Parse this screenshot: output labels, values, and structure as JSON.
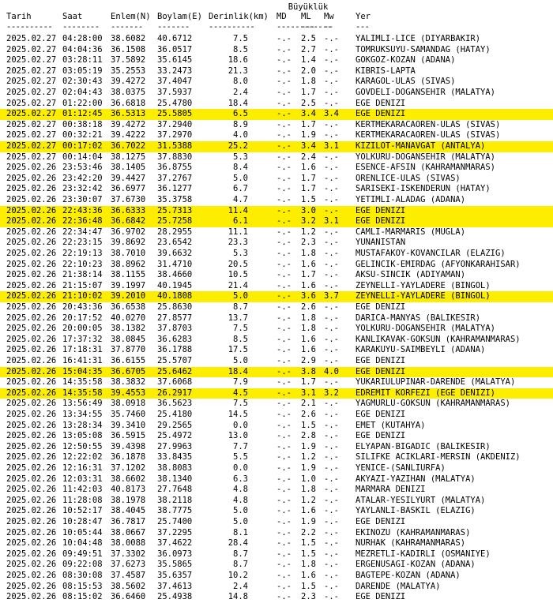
{
  "header": {
    "group_label": "Büyüklük",
    "columns": [
      "Tarih",
      "Saat",
      "Enlem(N)",
      "Boylam(E)",
      "Derinlik(km)",
      "MD",
      "ML",
      "Mw",
      "Yer"
    ],
    "separators": [
      "----------",
      "--------",
      "-------",
      "-------",
      "----------",
      "------------",
      "---",
      "--",
      "---"
    ]
  },
  "rows": [
    [
      "2025.02.27",
      "04:28:00",
      "38.6082",
      "40.6712",
      "7.5",
      "-.-",
      "2.5",
      "-.-",
      "YALIMLI-LICE (DIYARBAKIR)",
      false
    ],
    [
      "2025.02.27",
      "04:04:36",
      "36.1508",
      "36.0517",
      "8.5",
      "-.-",
      "2.7",
      "-.-",
      "TOMRUKSUYU-SAMANDAG (HATAY)",
      false
    ],
    [
      "2025.02.27",
      "03:28:11",
      "37.5892",
      "35.6145",
      "18.6",
      "-.-",
      "1.4",
      "-.-",
      "GOKGOZ-KOZAN (ADANA)",
      false
    ],
    [
      "2025.02.27",
      "03:05:19",
      "35.2553",
      "33.2473",
      "21.3",
      "-.-",
      "2.0",
      "-.-",
      "KIBRIS-LAPTA",
      false
    ],
    [
      "2025.02.27",
      "02:30:43",
      "39.4272",
      "37.4047",
      "8.0",
      "-.-",
      "1.8",
      "-.-",
      "KARAGOL-ULAS (SIVAS)",
      false
    ],
    [
      "2025.02.27",
      "02:04:43",
      "38.0375",
      "37.5937",
      "2.4",
      "-.-",
      "1.7",
      "-.-",
      "GOVDELI-DOGANSEHIR (MALATYA)",
      false
    ],
    [
      "2025.02.27",
      "01:22:00",
      "36.6818",
      "25.4780",
      "18.4",
      "-.-",
      "2.5",
      "-.-",
      "EGE DENIZI",
      false
    ],
    [
      "2025.02.27",
      "01:12:45",
      "36.5313",
      "25.5805",
      "6.5",
      "-.-",
      "3.4",
      "3.4",
      "EGE DENIZI",
      true
    ],
    [
      "2025.02.27",
      "00:38:18",
      "39.4272",
      "37.2940",
      "8.9",
      "-.-",
      "1.7",
      "-.-",
      "KERTMEKARACAOREN-ULAS (SIVAS)",
      false
    ],
    [
      "2025.02.27",
      "00:32:21",
      "39.4222",
      "37.2970",
      "4.0",
      "-.-",
      "1.9",
      "-.-",
      "KERTMEKARACAOREN-ULAS (SIVAS)",
      false
    ],
    [
      "2025.02.27",
      "00:17:02",
      "36.7022",
      "31.5388",
      "25.2",
      "-.-",
      "3.4",
      "3.1",
      "KIZILOT-MANAVGAT (ANTALYA)",
      true
    ],
    [
      "2025.02.27",
      "00:14:04",
      "38.1275",
      "37.8830",
      "5.3",
      "-.-",
      "2.4",
      "-.-",
      "YOLKURU-DOGANSEHIR (MALATYA)",
      false
    ],
    [
      "2025.02.26",
      "23:53:46",
      "38.1405",
      "36.8755",
      "8.4",
      "-.-",
      "1.6",
      "-.-",
      "ESENCE-AFSIN (KAHRAMANMARAS)",
      false
    ],
    [
      "2025.02.26",
      "23:42:20",
      "39.4427",
      "37.2767",
      "5.0",
      "-.-",
      "1.7",
      "-.-",
      "ORENLICE-ULAS (SIVAS)",
      false
    ],
    [
      "2025.02.26",
      "23:32:42",
      "36.6977",
      "36.1277",
      "6.7",
      "-.-",
      "1.7",
      "-.-",
      "SARISEKI-ISKENDERUN (HATAY)",
      false
    ],
    [
      "2025.02.26",
      "23:30:07",
      "37.6730",
      "35.3758",
      "4.7",
      "-.-",
      "1.5",
      "-.-",
      "YETIMLI-ALADAG (ADANA)",
      false
    ],
    [
      "2025.02.26",
      "22:43:36",
      "36.6333",
      "25.7313",
      "11.4",
      "-.-",
      "3.0",
      "-.-",
      "EGE DENIZI",
      true
    ],
    [
      "2025.02.26",
      "22:36:48",
      "36.6842",
      "25.7258",
      "6.1",
      "-.-",
      "3.2",
      "3.1",
      "EGE DENIZI",
      true
    ],
    [
      "2025.02.26",
      "22:34:47",
      "36.9702",
      "28.2955",
      "11.1",
      "-.-",
      "1.2",
      "-.-",
      "CAMLI-MARMARIS (MUGLA)",
      false
    ],
    [
      "2025.02.26",
      "22:23:15",
      "39.8692",
      "23.6542",
      "23.3",
      "-.-",
      "2.3",
      "-.-",
      "YUNANISTAN",
      false
    ],
    [
      "2025.02.26",
      "22:19:13",
      "38.7010",
      "39.6632",
      "5.3",
      "-.-",
      "1.8",
      "-.-",
      "MUSTAFAKOY-KOVANCILAR (ELAZIG)",
      false
    ],
    [
      "2025.02.26",
      "22:10:23",
      "38.8962",
      "31.4710",
      "20.5",
      "-.-",
      "1.6",
      "-.-",
      "GELINCIK-EMIRDAG (AFYONKARAHISAR)",
      false
    ],
    [
      "2025.02.26",
      "21:38:14",
      "38.1155",
      "38.4660",
      "10.5",
      "-.-",
      "1.7",
      "-.-",
      "AKSU-SINCIK (ADIYAMAN)",
      false
    ],
    [
      "2025.02.26",
      "21:15:07",
      "39.1997",
      "40.1945",
      "21.4",
      "-.-",
      "1.6",
      "-.-",
      "ZEYNELLI-YAYLADERE (BINGOL)",
      false
    ],
    [
      "2025.02.26",
      "21:10:02",
      "39.2010",
      "40.1808",
      "5.0",
      "-.-",
      "3.6",
      "3.7",
      "ZEYNELLI-YAYLADERE (BINGOL)",
      true
    ],
    [
      "2025.02.26",
      "20:43:36",
      "36.6538",
      "25.8630",
      "8.7",
      "-.-",
      "2.6",
      "-.-",
      "EGE DENIZI",
      false
    ],
    [
      "2025.02.26",
      "20:17:52",
      "40.0270",
      "27.8577",
      "13.7",
      "-.-",
      "1.8",
      "-.-",
      "DARICA-MANYAS (BALIKESIR)",
      false
    ],
    [
      "2025.02.26",
      "20:00:05",
      "38.1382",
      "37.8703",
      "7.5",
      "-.-",
      "1.8",
      "-.-",
      "YOLKURU-DOGANSEHIR (MALATYA)",
      false
    ],
    [
      "2025.02.26",
      "17:37:32",
      "38.0845",
      "36.6283",
      "8.5",
      "-.-",
      "1.6",
      "-.-",
      "KANLIKAVAK-GOKSUN (KAHRAMANMARAS)",
      false
    ],
    [
      "2025.02.26",
      "17:18:31",
      "37.8770",
      "36.1788",
      "17.5",
      "-.-",
      "1.6",
      "-.-",
      "KARAKUYU-SAIMBEYLI (ADANA)",
      false
    ],
    [
      "2025.02.26",
      "16:41:31",
      "36.6155",
      "25.5707",
      "5.0",
      "-.-",
      "2.9",
      "-.-",
      "EGE DENIZI",
      false
    ],
    [
      "2025.02.26",
      "15:04:35",
      "36.6705",
      "25.6462",
      "18.4",
      "-.-",
      "3.8",
      "4.0",
      "EGE DENIZI",
      true
    ],
    [
      "2025.02.26",
      "14:35:58",
      "38.3832",
      "37.6068",
      "7.9",
      "-.-",
      "1.7",
      "-.-",
      "YUKARIULUPINAR-DARENDE (MALATYA)",
      false
    ],
    [
      "2025.02.26",
      "14:35:58",
      "39.4553",
      "26.2917",
      "4.5",
      "-.-",
      "3.1",
      "3.2",
      "EDREMIT KORFEZI (EGE DENIZI)",
      true
    ],
    [
      "2025.02.26",
      "13:56:49",
      "38.0918",
      "36.5623",
      "7.5",
      "-.-",
      "2.1",
      "-.-",
      "YAGMURLU-GOKSUN (KAHRAMANMARAS)",
      false
    ],
    [
      "2025.02.26",
      "13:34:55",
      "35.7460",
      "25.4180",
      "14.5",
      "-.-",
      "2.6",
      "-.-",
      "EGE DENIZI",
      false
    ],
    [
      "2025.02.26",
      "13:28:34",
      "39.3410",
      "29.2565",
      "0.0",
      "-.-",
      "1.5",
      "-.-",
      "EMET (KUTAHYA)",
      false
    ],
    [
      "2025.02.26",
      "13:05:08",
      "36.5915",
      "25.4972",
      "13.0",
      "-.-",
      "2.8",
      "-.-",
      "EGE DENIZI",
      false
    ],
    [
      "2025.02.26",
      "12:50:55",
      "39.4398",
      "27.9963",
      "7.7",
      "-.-",
      "1.9",
      "-.-",
      "ELYAPAN-BIGADIC (BALIKESIR)",
      false
    ],
    [
      "2025.02.26",
      "12:22:02",
      "36.1878",
      "33.8435",
      "5.5",
      "-.-",
      "1.2",
      "-.-",
      "SILIFKE ACIKLARI-MERSIN (AKDENIZ)",
      false
    ],
    [
      "2025.02.26",
      "12:16:31",
      "37.1202",
      "38.8083",
      "0.0",
      "-.-",
      "1.9",
      "-.-",
      "YENICE-(SANLIURFA)",
      false
    ],
    [
      "2025.02.26",
      "12:03:31",
      "38.6602",
      "38.1340",
      "6.3",
      "-.-",
      "1.0",
      "-.-",
      "AKYAZI-YAZIHAN (MALATYA)",
      false
    ],
    [
      "2025.02.26",
      "11:42:03",
      "40.8173",
      "27.7648",
      "4.8",
      "-.-",
      "1.8",
      "-.-",
      "MARMARA DENIZI",
      false
    ],
    [
      "2025.02.26",
      "11:28:08",
      "38.1978",
      "38.2118",
      "4.8",
      "-.-",
      "1.2",
      "-.-",
      "ATALAR-YESILYURT (MALATYA)",
      false
    ],
    [
      "2025.02.26",
      "10:52:17",
      "38.4045",
      "38.7775",
      "5.0",
      "-.-",
      "1.6",
      "-.-",
      "YAYLANLI-BASKIL (ELAZIG)",
      false
    ],
    [
      "2025.02.26",
      "10:28:47",
      "36.7817",
      "25.7400",
      "5.0",
      "-.-",
      "1.9",
      "-.-",
      "EGE DENIZI",
      false
    ],
    [
      "2025.02.26",
      "10:05:44",
      "38.0667",
      "37.2295",
      "8.1",
      "-.-",
      "2.2",
      "-.-",
      "EKINOZU (KAHRAMANMARAS)",
      false
    ],
    [
      "2025.02.26",
      "10:04:48",
      "38.0088",
      "37.4622",
      "28.4",
      "-.-",
      "1.5",
      "-.-",
      "NURHAK (KAHRAMANMARAS)",
      false
    ],
    [
      "2025.02.26",
      "09:49:51",
      "37.3302",
      "36.0973",
      "8.7",
      "-.-",
      "1.5",
      "-.-",
      "MEZRETLI-KADIRLI (OSMANIYE)",
      false
    ],
    [
      "2025.02.26",
      "09:22:08",
      "37.6273",
      "35.5865",
      "8.7",
      "-.-",
      "1.8",
      "-.-",
      "ERGENUSAGI-KOZAN (ADANA)",
      false
    ],
    [
      "2025.02.26",
      "08:30:08",
      "37.4587",
      "35.6357",
      "10.2",
      "-.-",
      "1.6",
      "-.-",
      "BAGTEPE-KOZAN (ADANA)",
      false
    ],
    [
      "2025.02.26",
      "08:15:53",
      "38.5602",
      "37.4613",
      "2.4",
      "-.-",
      "1.5",
      "-.-",
      "DARENDE (MALATYA)",
      false
    ],
    [
      "2025.02.26",
      "08:15:02",
      "36.6460",
      "25.4938",
      "14.8",
      "-.-",
      "2.3",
      "-.-",
      "EGE DENIZI",
      false
    ]
  ]
}
